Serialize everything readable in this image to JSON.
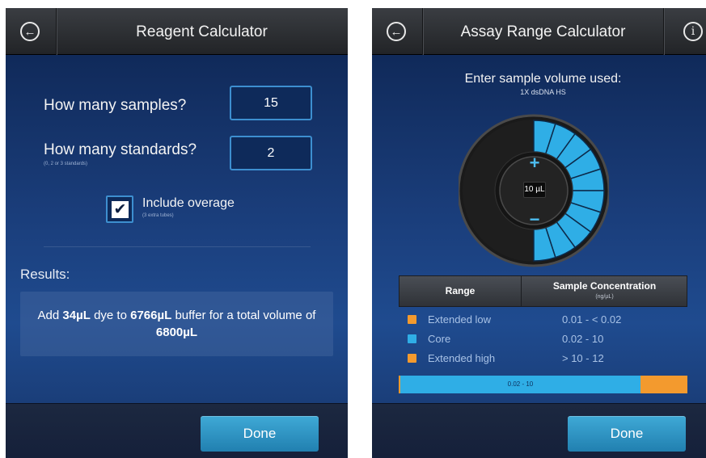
{
  "colors": {
    "accent_blue": "#2faee6",
    "accent_orange": "#f39a2e",
    "header_bg": "#2a2c30",
    "body_bg": "#1a3d7a",
    "button_bg": "#2f95c5"
  },
  "reagent_screen": {
    "title": "Reagent Calculator",
    "back_icon": "back-arrow-circle-icon",
    "samples_label": "How many samples?",
    "samples_value": "15",
    "standards_label": "How many standards?",
    "standards_value": "2",
    "standards_hint": "(0, 2 or 3 standards)",
    "overage_label": "Include overage",
    "overage_hint": "(3 extra tubes)",
    "overage_checked": true,
    "results_title": "Results:",
    "results": {
      "prefix": "Add ",
      "dye": "34µL",
      "mid1": " dye to ",
      "buffer": "6766µL",
      "mid2": " buffer for a total volume of ",
      "total": "6800µL"
    },
    "done_label": "Done"
  },
  "assay_screen": {
    "title": "Assay Range Calculator",
    "back_icon": "back-arrow-circle-icon",
    "info_icon": "info-circle-icon",
    "prompt": "Enter sample volume used:",
    "assay_name": "1X dsDNA HS",
    "plus_label": "+",
    "minus_label": "−",
    "volume_value": "10 µL",
    "dial": {
      "total_segments": 20,
      "active_segments": 10
    },
    "table": {
      "header_range": "Range",
      "header_concentration": "Sample Concentration",
      "header_unit": "(ng/µL)",
      "rows": [
        {
          "name": "Extended low",
          "value": "0.01  -  < 0.02",
          "color": "#f39a2e"
        },
        {
          "name": "Core",
          "value": "0.02  -  10",
          "color": "#2faee6"
        },
        {
          "name": "Extended high",
          "value": "> 10  -  12",
          "color": "#f39a2e"
        }
      ]
    },
    "range_bar": {
      "core_label": "0.02 - 10",
      "low_fraction": 0.005,
      "core_fraction": 0.833,
      "high_fraction": 0.162
    },
    "done_label": "Done"
  }
}
